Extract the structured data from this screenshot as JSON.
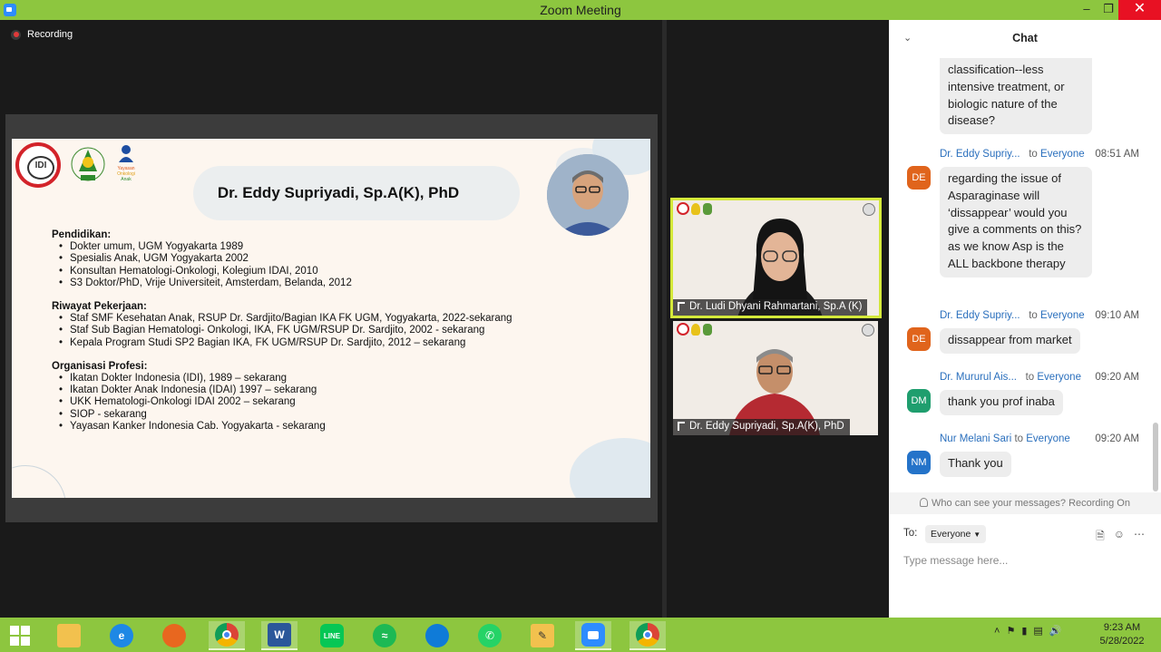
{
  "window": {
    "title": "Zoom Meeting"
  },
  "recording": {
    "label": "Recording"
  },
  "slide": {
    "title": "Dr. Eddy Supriyadi, Sp.A(K), PhD",
    "sections": [
      {
        "heading": "Pendidikan:",
        "items": [
          "Dokter umum, UGM Yogyakarta 1989",
          "Spesialis Anak, UGM Yogyakarta 2002",
          "Konsultan Hematologi-Onkologi, Kolegium IDAI, 2010",
          "S3 Doktor/PhD, Vrije Universiteit, Amsterdam, Belanda, 2012"
        ]
      },
      {
        "heading": "Riwayat Pekerjaan:",
        "items": [
          "Staf SMF Kesehatan Anak, RSUP Dr. Sardjito/Bagian IKA FK UGM, Yogyakarta, 2022-sekarang",
          "Staf Sub Bagian Hematologi- Onkologi, IKA, FK UGM/RSUP Dr. Sardjito, 2002 - sekarang",
          "Kepala Program Studi SP2 Bagian IKA, FK UGM/RSUP Dr. Sardjito, 2012 – sekarang"
        ]
      },
      {
        "heading": "Organisasi Profesi:",
        "items": [
          "Ikatan Dokter Indonesia (IDI), 1989 – sekarang",
          "Ikatan Dokter Anak Indonesia (IDAI) 1997 – sekarang",
          "UKK Hematologi-Onkologi IDAI 2002 – sekarang",
          "SIOP - sekarang",
          "Yayasan Kanker Indonesia Cab. Yogyakarta - sekarang"
        ]
      }
    ]
  },
  "participants": [
    {
      "name": "Dr. Ludi Dhyani Rahmartani, Sp.A (K)"
    },
    {
      "name": "Dr. Eddy Supriyadi, Sp.A(K), PhD"
    }
  ],
  "chat": {
    "title": "Chat",
    "partial_message": "classification--less intensive treatment, or biologic nature of the disease?",
    "messages": [
      {
        "sender": "Dr. Eddy Supriy...",
        "to": "to",
        "recipient": "Everyone",
        "time": "08:51 AM",
        "initials": "DE",
        "color": "#e0641c",
        "text": "regarding the issue of Asparaginase will ‘dissappear’ would you give a comments on this? as we know Asp is the ALL backbone therapy"
      },
      {
        "sender": "Dr. Eddy Supriy...",
        "to": "to",
        "recipient": "Everyone",
        "time": "09:10 AM",
        "initials": "DE",
        "color": "#e0641c",
        "text": "dissappear from market"
      },
      {
        "sender": "Dr. Mururul Ais...",
        "to": "to",
        "recipient": "Everyone",
        "time": "09:20 AM",
        "initials": "DM",
        "color": "#1f9e6e",
        "text": "thank you prof inaba"
      },
      {
        "sender": "Nur Melani Sari",
        "to": "to",
        "recipient": "Everyone",
        "time": "09:20 AM",
        "initials": "NM",
        "color": "#2473c9",
        "text": "Thank you"
      }
    ],
    "who_can_see": "Who can see your messages? Recording On",
    "to_label": "To:",
    "to_value": "Everyone",
    "input_placeholder": "Type message here..."
  },
  "taskbar": {
    "apps": [
      "start",
      "file-explorer",
      "internet-explorer",
      "firefox",
      "chrome",
      "word",
      "line",
      "spotify",
      "edge",
      "whatsapp",
      "stylus-app",
      "zoom",
      "chrome-profile"
    ],
    "time": "9:23 AM",
    "date": "5/28/2022"
  }
}
